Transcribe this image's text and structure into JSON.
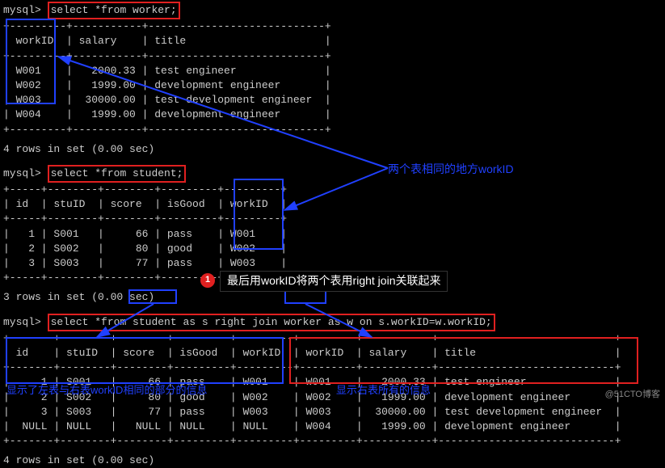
{
  "prompt": "mysql>",
  "q1": {
    "sql": "select *from worker;",
    "cols": [
      "workID",
      "salary",
      "title"
    ],
    "rows": [
      [
        "W001",
        "2000.33",
        "test engineer"
      ],
      [
        "W002",
        "1999.00",
        "development engineer"
      ],
      [
        "W003",
        "30000.00",
        "test development engineer"
      ],
      [
        "W004",
        "1999.00",
        "development engineer"
      ]
    ],
    "footer": "4 rows in set (0.00 sec)"
  },
  "q2": {
    "sql": "select *from student;",
    "cols": [
      "id",
      "stuID",
      "score",
      "isGood",
      "workID"
    ],
    "rows": [
      [
        "1",
        "S001",
        "66",
        "pass",
        "W001"
      ],
      [
        "2",
        "S002",
        "80",
        "good",
        "W002"
      ],
      [
        "3",
        "S003",
        "77",
        "pass",
        "W003"
      ]
    ],
    "footer": "3 rows in set (0.00 sec)"
  },
  "q3": {
    "sql_pre": "select *from ",
    "sql_kw1": "student",
    "sql_mid1": " as s right join ",
    "sql_kw2": "worker",
    "sql_mid2": " as w on s.workID=w.workID;",
    "cols": [
      "id",
      "stuID",
      "score",
      "isGood",
      "workID",
      "workID",
      "salary",
      "title"
    ],
    "rows": [
      [
        "1",
        "S001",
        "66",
        "pass",
        "W001",
        "W001",
        "2000.33",
        "test engineer"
      ],
      [
        "2",
        "S002",
        "80",
        "good",
        "W002",
        "W002",
        "1999.00",
        "development engineer"
      ],
      [
        "3",
        "S003",
        "77",
        "pass",
        "W003",
        "W003",
        "30000.00",
        "test development engineer"
      ],
      [
        "NULL",
        "NULL",
        "NULL",
        "NULL",
        "NULL",
        "W004",
        "1999.00",
        "development engineer"
      ]
    ],
    "footer": "4 rows in set (0.00 sec)"
  },
  "annotations": {
    "right_label": "两个表相同的地方workID",
    "step_num": "1",
    "step_text": "最后用workID将两个表用right join关联起来",
    "bottom_left": "显示了左表与右表workID相同的部分的信息",
    "bottom_right": "显示右表所有的信息"
  },
  "watermark": "@51CTO博客"
}
